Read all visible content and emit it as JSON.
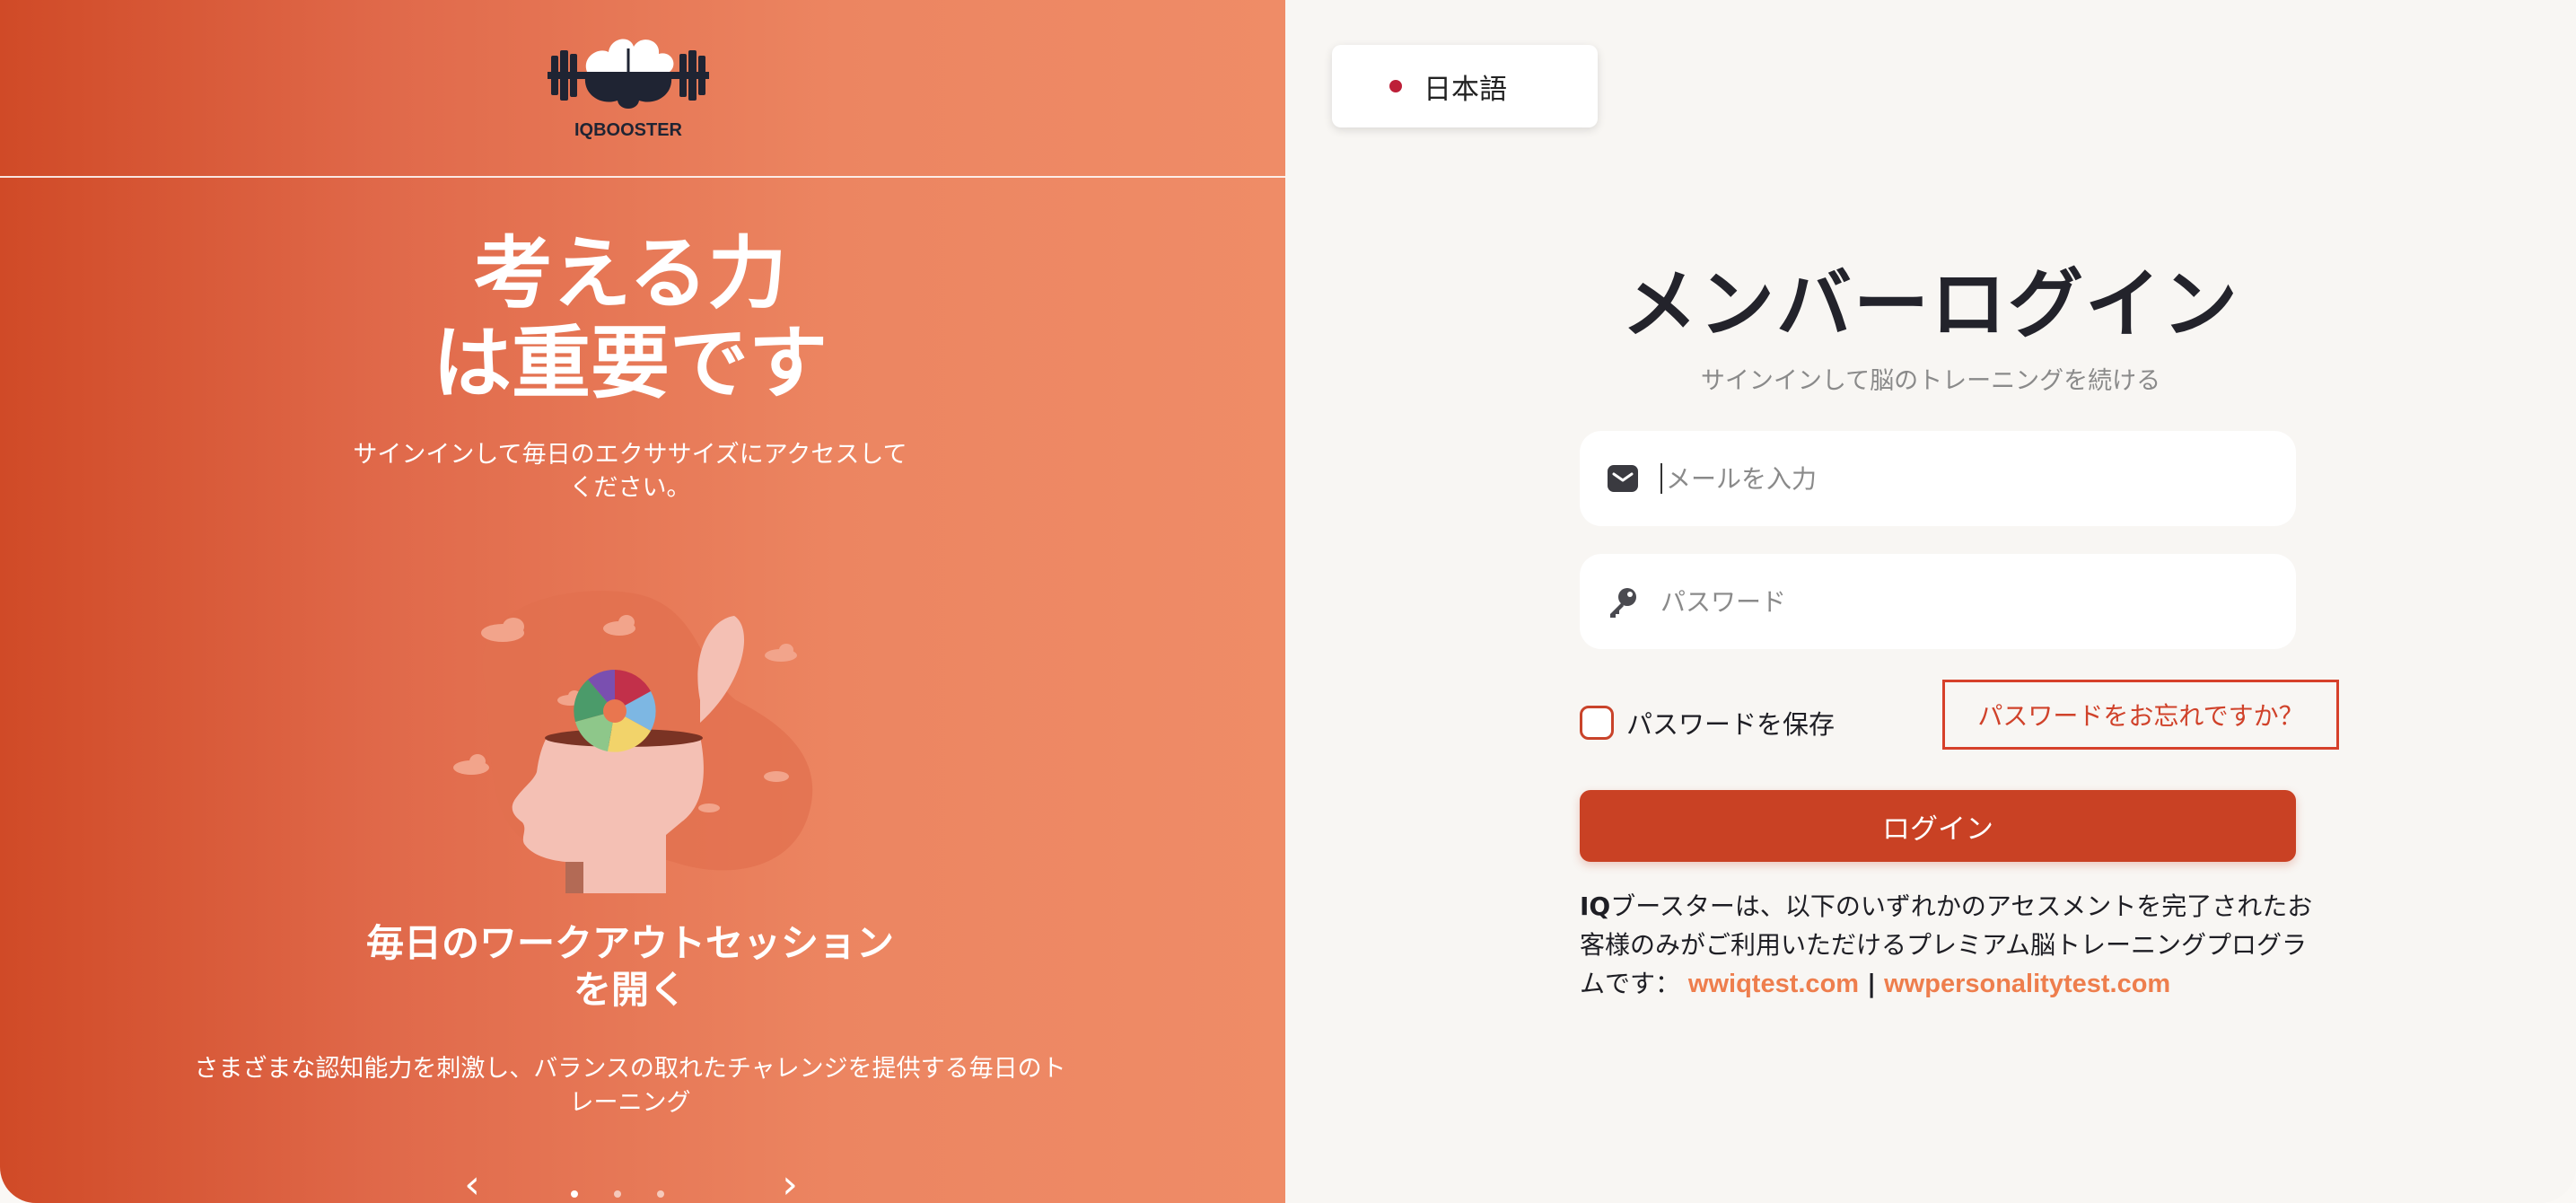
{
  "branding": {
    "logo_text": "IQBOOSTER"
  },
  "left": {
    "hero_title_line1": "考える力",
    "hero_title_line2": "は重要です",
    "hero_subtitle": "サインインして毎日のエクササイズにアクセスしてください。",
    "slide": {
      "title": "毎日のワークアウトセッションを開く",
      "description": "さまざまな認知能力を刺激し、バランスの取れたチャレンジを提供する毎日のトレーニング",
      "prev_icon": "‹",
      "next_icon": "›",
      "total_slides": 3,
      "active_slide": 1
    }
  },
  "language": {
    "label": "日本語",
    "dot_color": "#bd1f38"
  },
  "login": {
    "title": "メンバーログイン",
    "subtitle": "サインインして脳のトレーニングを続ける",
    "email_placeholder": "メールを入力",
    "password_placeholder": "パスワード",
    "remember_label": "パスワードを保存",
    "forgot_label": "パスワードをお忘れですか？",
    "submit_label": "ログイン",
    "info_prefix": "IQ",
    "info_text": "ブースターは、以下のいずれかのアセスメントを完了されたお客様のみがご利用いただけるプレミアム脳トレーニングプログラムです：",
    "link1": "wwiqtest.com",
    "link_separator": "|",
    "link2": "wwpersonalitytest.com"
  },
  "colors": {
    "accent": "#c94124",
    "link": "#ee7e4d",
    "panel_gradient_start": "#d04a27",
    "panel_gradient_end": "#ef8c67"
  },
  "icons": {
    "email": "envelope-icon",
    "password": "key-icon"
  }
}
